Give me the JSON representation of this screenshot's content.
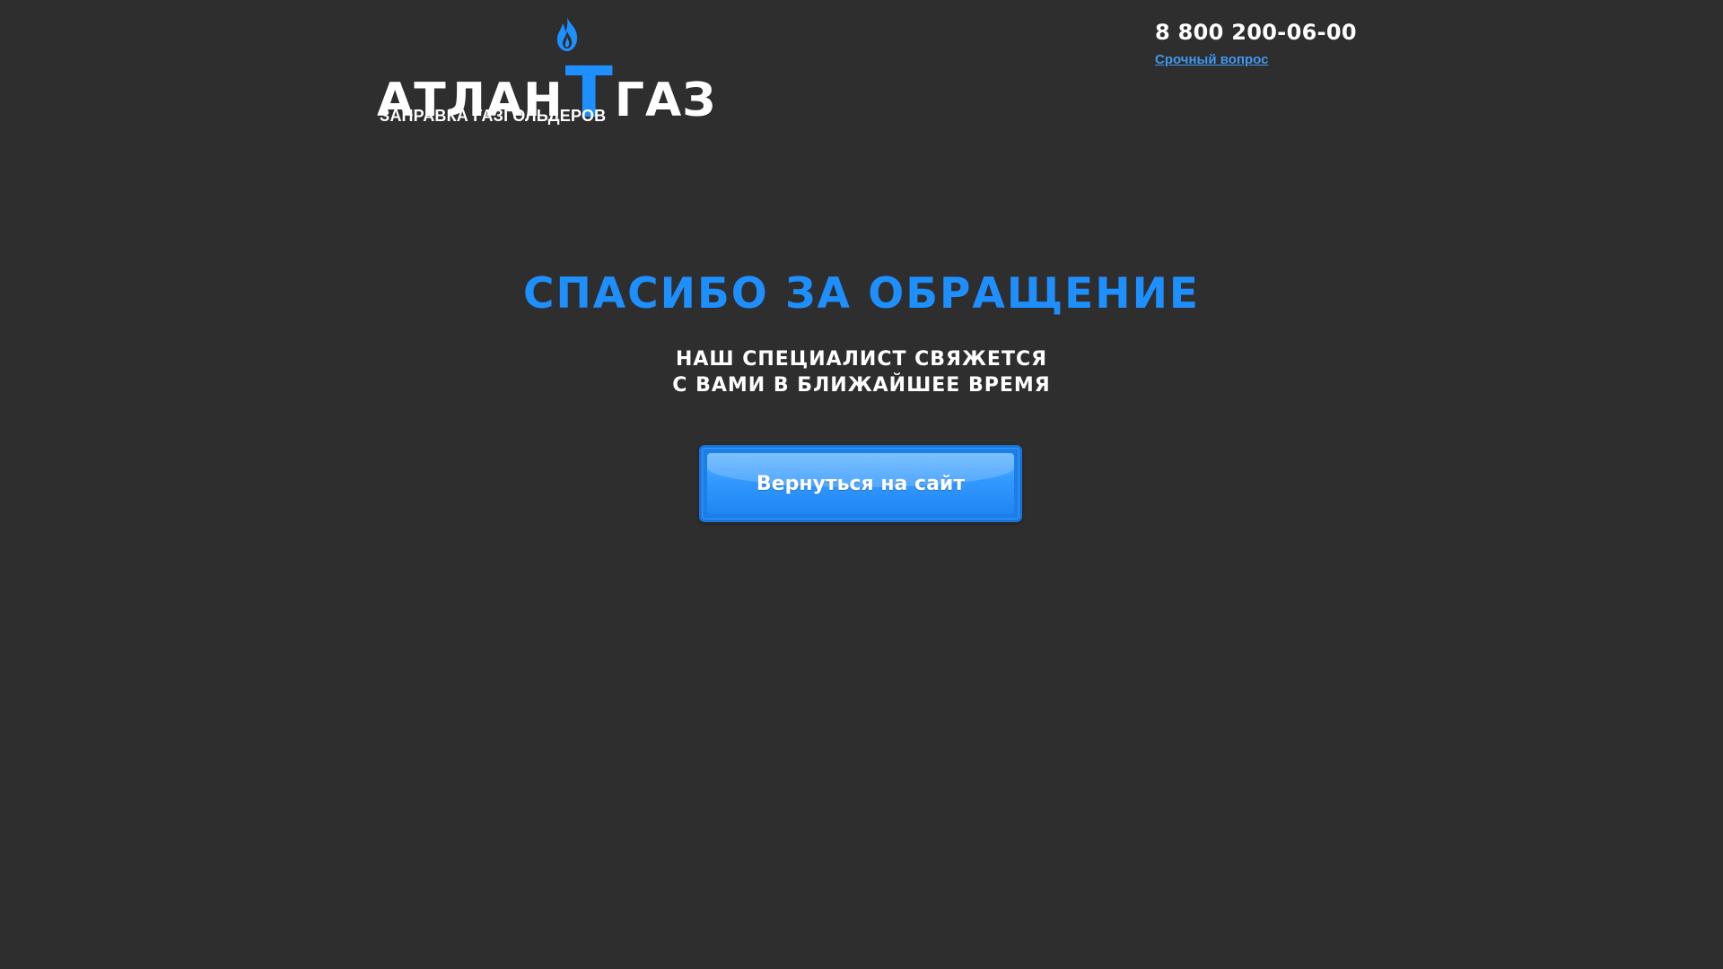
{
  "logo": {
    "word_left": "АТЛАН",
    "word_t": "Т",
    "word_right": "ГАЗ",
    "tagline": "ЗАПРАВКА ГАЗГОЛЬДЕРОВ",
    "icon": "flame-icon"
  },
  "header": {
    "phone": "8 800 200-06-00",
    "urgent_link": "Срочный вопрос"
  },
  "main": {
    "title": "СПАСИБО ЗА ОБРАЩЕНИЕ",
    "subtitle_line1": "НАШ СПЕЦИАЛИСТ СВЯЖЕТСЯ",
    "subtitle_line2": "С ВАМИ В БЛИЖАЙШЕЕ ВРЕМЯ",
    "back_button": "Вернуться на сайт"
  },
  "colors": {
    "background": "#2e2e2e",
    "accent": "#1e8fff",
    "link": "#3f97f0",
    "text": "#ffffff"
  }
}
